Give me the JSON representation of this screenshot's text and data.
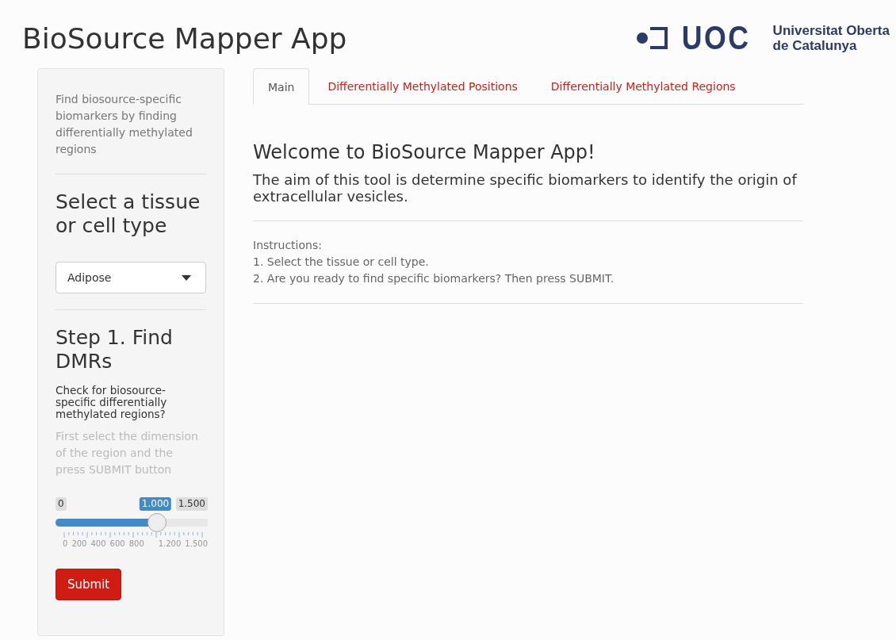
{
  "app_title": "BioSource Mapper App",
  "logo": {
    "mark": "UOC",
    "name_lines": [
      "Universitat Oberta",
      "de Catalunya"
    ]
  },
  "sidebar": {
    "description": "Find biosource-specific biomarkers by finding differentially methylated regions",
    "select_heading": "Select a tissue or cell type",
    "dropdown": {
      "value": "Adipose"
    },
    "step_heading": "Step 1. Find DMRs",
    "question": "Check for biosource-specific differentially methylated regions?",
    "help": "First select the dimension of the region and the press SUBMIT button",
    "slider": {
      "min": "0",
      "value": "1.000",
      "max": "1.500",
      "level": 0.667,
      "tick_labels": [
        "0",
        "200",
        "400",
        "600",
        "800",
        "1.200",
        "1.500"
      ]
    },
    "submit": "Submit"
  },
  "tabs": [
    {
      "label": "Main",
      "selected": true
    },
    {
      "label": "Differentially Methylated Positions",
      "selected": false
    },
    {
      "label": "Differentially Methylated Regions",
      "selected": false
    }
  ],
  "main": {
    "heading": "Welcome to BioSource Mapper App!",
    "intro": "The aim of this tool is determine specific biomarkers to identify the origin of extracellular vesicles.",
    "instructions": [
      "Instructions:",
      "1. Select the tissue or cell type.",
      "2. Are you ready to find specific biomarkers? Then press SUBMIT."
    ]
  }
}
